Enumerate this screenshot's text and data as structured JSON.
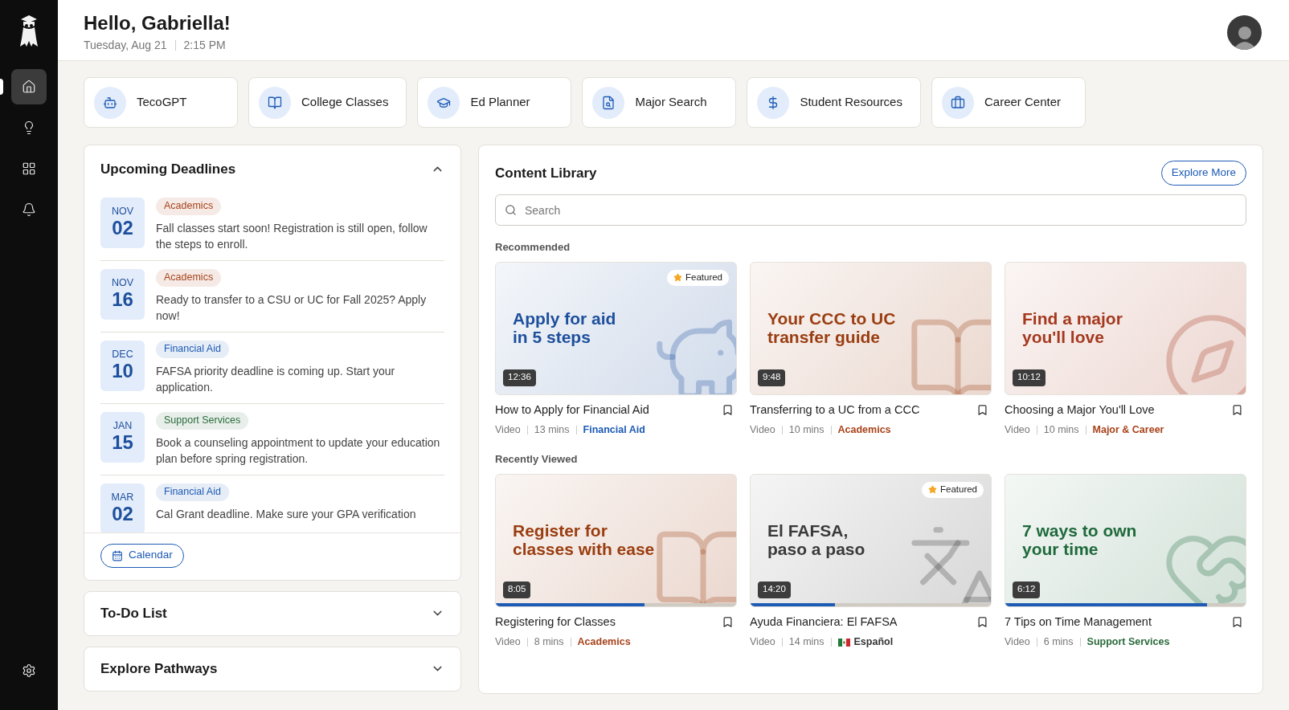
{
  "sidebar": {
    "items": [
      {
        "kind": "home",
        "selected": true
      },
      {
        "kind": "ideas",
        "selected": false
      },
      {
        "kind": "apps",
        "selected": false
      },
      {
        "kind": "alerts",
        "selected": false
      }
    ]
  },
  "header": {
    "greeting": "Hello, Gabriella!",
    "date": "Tuesday, Aug 21",
    "time": "2:15 PM"
  },
  "quick_links": [
    {
      "label": "TecoGPT",
      "kind": "bot"
    },
    {
      "label": "College Classes",
      "kind": "book"
    },
    {
      "label": "Ed Planner",
      "kind": "cap"
    },
    {
      "label": "Major Search",
      "kind": "file-search"
    },
    {
      "label": "Student Resources",
      "kind": "dollar"
    },
    {
      "label": "Career Center",
      "kind": "briefcase"
    }
  ],
  "deadlines": {
    "title": "Upcoming Deadlines",
    "expanded": true,
    "items": [
      {
        "month": "NOV",
        "day": "02",
        "tag": "Academics",
        "color": "#a8431b",
        "text": "Fall classes start soon! Registration is still open, follow the steps to enroll."
      },
      {
        "month": "NOV",
        "day": "16",
        "tag": "Academics",
        "color": "#a8431b",
        "text": "Ready to transfer to a CSU or UC for Fall 2025? Apply now!"
      },
      {
        "month": "DEC",
        "day": "10",
        "tag": "Financial Aid",
        "color": "#1d5bb5",
        "text": "FAFSA priority deadline is coming up. Start your application."
      },
      {
        "month": "JAN",
        "day": "15",
        "tag": "Support Services",
        "color": "#2a6b3c",
        "text": "Book a counseling appointment to update your education plan before spring registration."
      },
      {
        "month": "MAR",
        "day": "02",
        "tag": "Financial Aid",
        "color": "#1d5bb5",
        "text": "Cal Grant deadline. Make sure your GPA verification"
      }
    ],
    "button": "Calendar"
  },
  "collapsed_panels": [
    {
      "title": "To-Do List",
      "expanded": false
    },
    {
      "title": "Explore Pathways",
      "expanded": false
    }
  ],
  "content_library": {
    "title": "Content Library",
    "button": "Explore More",
    "search": {
      "placeholder": "Search"
    },
    "sections": [
      {
        "title": "Recommended",
        "videos": [
          {
            "headline": [
              "Apply for aid",
              "in 5 steps"
            ],
            "kind": "piggy",
            "color": "#1d4f9c",
            "featured": true,
            "featured_label": "Featured",
            "duration": "12:36",
            "title": "How to Apply for Financial Aid",
            "type": "Video",
            "length": "13 mins",
            "category": {
              "kind": "topic",
              "label": "Financial Aid",
              "color": "#1d5bb5"
            }
          },
          {
            "headline": [
              "Your CCC to UC",
              "transfer guide"
            ],
            "kind": "book",
            "color": "#9a3d10",
            "featured": false,
            "duration": "9:48",
            "title": "Transferring to a UC from a CCC",
            "type": "Video",
            "length": "10 mins",
            "category": {
              "kind": "topic",
              "label": "Academics",
              "color": "#a8431b"
            }
          },
          {
            "headline": [
              "Find a major",
              "you'll love"
            ],
            "kind": "compass",
            "color": "#a4391f",
            "featured": false,
            "duration": "10:12",
            "title": "Choosing a Major You'll Love",
            "type": "Video",
            "length": "10 mins",
            "category": {
              "kind": "topic",
              "label": "Major & Career",
              "color": "#a8431b"
            }
          }
        ]
      },
      {
        "title": "Recently Viewed",
        "videos": [
          {
            "headline": [
              "Register for",
              "classes with ease"
            ],
            "kind": "book",
            "color": "#9a3d10",
            "featured": false,
            "duration": "8:05",
            "level": 0.62,
            "title": "Registering for Classes",
            "type": "Video",
            "length": "8 mins",
            "category": {
              "kind": "topic",
              "label": "Academics",
              "color": "#a8431b"
            }
          },
          {
            "headline": [
              "El FAFSA,",
              "paso a paso"
            ],
            "kind": "translate",
            "color": "#3a3a3a",
            "featured": true,
            "featured_label": "Featured",
            "duration": "14:20",
            "level": 0.35,
            "title": "Ayuda Financiera: El FAFSA",
            "type": "Video",
            "length": "14 mins",
            "category": {
              "kind": "language",
              "label": "Español",
              "color": "#333333"
            }
          },
          {
            "headline": [
              "7 ways to own",
              "your time"
            ],
            "kind": "heart",
            "color": "#1f6a3c",
            "featured": false,
            "duration": "6:12",
            "level": 0.84,
            "title": "7 Tips on Time Management",
            "type": "Video",
            "length": "6 mins",
            "category": {
              "kind": "topic",
              "label": "Support Services",
              "color": "#2a6b3c"
            }
          }
        ]
      }
    ]
  }
}
